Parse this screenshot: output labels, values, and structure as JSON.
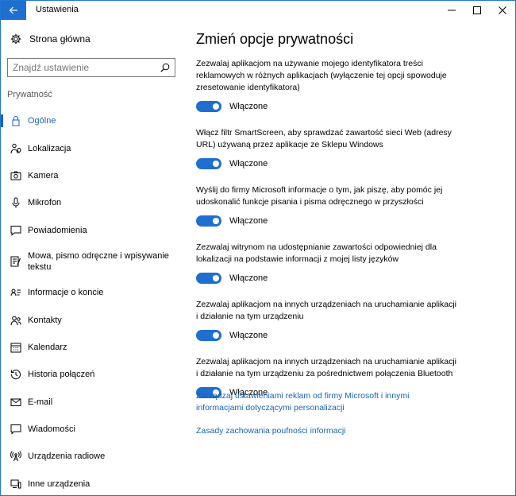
{
  "window": {
    "title": "Ustawienia"
  },
  "sidebar": {
    "home_label": "Strona główna",
    "search_placeholder": "Znajdź ustawienie",
    "section_label": "Prywatność",
    "items": [
      {
        "label": "Ogólne",
        "icon": "lock-icon",
        "active": true
      },
      {
        "label": "Lokalizacja",
        "icon": "person-location-icon"
      },
      {
        "label": "Kamera",
        "icon": "camera-icon"
      },
      {
        "label": "Mikrofon",
        "icon": "microphone-icon"
      },
      {
        "label": "Powiadomienia",
        "icon": "speech-bubble-icon"
      },
      {
        "label": "Mowa, pismo odręczne i wpisywanie tekstu",
        "icon": "notepad-pen-icon"
      },
      {
        "label": "Informacje o koncie",
        "icon": "account-card-icon"
      },
      {
        "label": "Kontakty",
        "icon": "contacts-icon"
      },
      {
        "label": "Kalendarz",
        "icon": "calendar-icon"
      },
      {
        "label": "Historia połączeń",
        "icon": "history-icon"
      },
      {
        "label": "E-mail",
        "icon": "mail-icon"
      },
      {
        "label": "Wiadomości",
        "icon": "message-icon"
      },
      {
        "label": "Urządzenia radiowe",
        "icon": "radio-tower-icon"
      },
      {
        "label": "Inne urządzenia",
        "icon": "devices-icon"
      }
    ]
  },
  "main": {
    "title": "Zmień opcje prywatności",
    "settings": [
      {
        "description": "Zezwalaj aplikacjom na używanie mojego identyfikatora treści reklamowych w różnych aplikacjach (wyłączenie tej opcji spowoduje zresetowanie identyfikatora)",
        "state_label": "Włączone",
        "on": true
      },
      {
        "description": "Włącz filtr SmartScreen, aby sprawdzać zawartość sieci Web (adresy URL) używaną przez aplikacje ze Sklepu Windows",
        "state_label": "Włączone",
        "on": true
      },
      {
        "description": "Wyślij do firmy Microsoft informacje o tym, jak piszę, aby pomóc jej udoskonalić funkcje pisania i pisma odręcznego w przyszłości",
        "state_label": "Włączone",
        "on": true
      },
      {
        "description": "Zezwalaj witrynom na udostępnianie zawartości odpowiedniej dla lokalizacji na podstawie informacji z mojej listy języków",
        "state_label": "Włączone",
        "on": true
      },
      {
        "description": "Zezwalaj aplikacjom na innych urządzeniach na uruchamianie aplikacji i działanie na tym urządzeniu",
        "state_label": "Włączone",
        "on": true
      },
      {
        "description": "Zezwalaj aplikacjom na innych urządzeniach na uruchamianie aplikacji i działanie na tym urządzeniu za pośrednictwem połączenia Bluetooth",
        "state_label": "Włączone",
        "on": true
      }
    ],
    "links": [
      "Zarządzaj ustawieniami reklam od firmy Microsoft i innymi informacjami dotyczącymi personalizacji",
      "Zasady zachowania poufności informacji"
    ]
  },
  "colors": {
    "accent": "#1e6fd0",
    "link": "#1a62b8"
  }
}
